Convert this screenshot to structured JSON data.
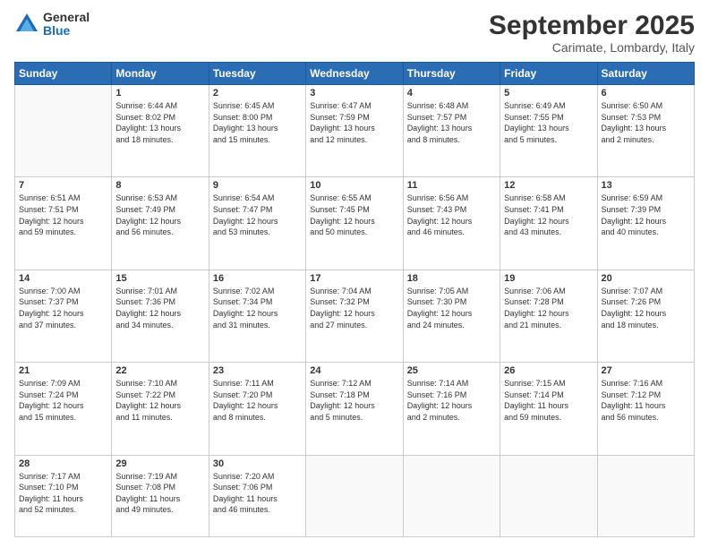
{
  "logo": {
    "general": "General",
    "blue": "Blue"
  },
  "title": "September 2025",
  "subtitle": "Carimate, Lombardy, Italy",
  "headers": [
    "Sunday",
    "Monday",
    "Tuesday",
    "Wednesday",
    "Thursday",
    "Friday",
    "Saturday"
  ],
  "weeks": [
    [
      {
        "day": "",
        "info": ""
      },
      {
        "day": "1",
        "info": "Sunrise: 6:44 AM\nSunset: 8:02 PM\nDaylight: 13 hours\nand 18 minutes."
      },
      {
        "day": "2",
        "info": "Sunrise: 6:45 AM\nSunset: 8:00 PM\nDaylight: 13 hours\nand 15 minutes."
      },
      {
        "day": "3",
        "info": "Sunrise: 6:47 AM\nSunset: 7:59 PM\nDaylight: 13 hours\nand 12 minutes."
      },
      {
        "day": "4",
        "info": "Sunrise: 6:48 AM\nSunset: 7:57 PM\nDaylight: 13 hours\nand 8 minutes."
      },
      {
        "day": "5",
        "info": "Sunrise: 6:49 AM\nSunset: 7:55 PM\nDaylight: 13 hours\nand 5 minutes."
      },
      {
        "day": "6",
        "info": "Sunrise: 6:50 AM\nSunset: 7:53 PM\nDaylight: 13 hours\nand 2 minutes."
      }
    ],
    [
      {
        "day": "7",
        "info": "Sunrise: 6:51 AM\nSunset: 7:51 PM\nDaylight: 12 hours\nand 59 minutes."
      },
      {
        "day": "8",
        "info": "Sunrise: 6:53 AM\nSunset: 7:49 PM\nDaylight: 12 hours\nand 56 minutes."
      },
      {
        "day": "9",
        "info": "Sunrise: 6:54 AM\nSunset: 7:47 PM\nDaylight: 12 hours\nand 53 minutes."
      },
      {
        "day": "10",
        "info": "Sunrise: 6:55 AM\nSunset: 7:45 PM\nDaylight: 12 hours\nand 50 minutes."
      },
      {
        "day": "11",
        "info": "Sunrise: 6:56 AM\nSunset: 7:43 PM\nDaylight: 12 hours\nand 46 minutes."
      },
      {
        "day": "12",
        "info": "Sunrise: 6:58 AM\nSunset: 7:41 PM\nDaylight: 12 hours\nand 43 minutes."
      },
      {
        "day": "13",
        "info": "Sunrise: 6:59 AM\nSunset: 7:39 PM\nDaylight: 12 hours\nand 40 minutes."
      }
    ],
    [
      {
        "day": "14",
        "info": "Sunrise: 7:00 AM\nSunset: 7:37 PM\nDaylight: 12 hours\nand 37 minutes."
      },
      {
        "day": "15",
        "info": "Sunrise: 7:01 AM\nSunset: 7:36 PM\nDaylight: 12 hours\nand 34 minutes."
      },
      {
        "day": "16",
        "info": "Sunrise: 7:02 AM\nSunset: 7:34 PM\nDaylight: 12 hours\nand 31 minutes."
      },
      {
        "day": "17",
        "info": "Sunrise: 7:04 AM\nSunset: 7:32 PM\nDaylight: 12 hours\nand 27 minutes."
      },
      {
        "day": "18",
        "info": "Sunrise: 7:05 AM\nSunset: 7:30 PM\nDaylight: 12 hours\nand 24 minutes."
      },
      {
        "day": "19",
        "info": "Sunrise: 7:06 AM\nSunset: 7:28 PM\nDaylight: 12 hours\nand 21 minutes."
      },
      {
        "day": "20",
        "info": "Sunrise: 7:07 AM\nSunset: 7:26 PM\nDaylight: 12 hours\nand 18 minutes."
      }
    ],
    [
      {
        "day": "21",
        "info": "Sunrise: 7:09 AM\nSunset: 7:24 PM\nDaylight: 12 hours\nand 15 minutes."
      },
      {
        "day": "22",
        "info": "Sunrise: 7:10 AM\nSunset: 7:22 PM\nDaylight: 12 hours\nand 11 minutes."
      },
      {
        "day": "23",
        "info": "Sunrise: 7:11 AM\nSunset: 7:20 PM\nDaylight: 12 hours\nand 8 minutes."
      },
      {
        "day": "24",
        "info": "Sunrise: 7:12 AM\nSunset: 7:18 PM\nDaylight: 12 hours\nand 5 minutes."
      },
      {
        "day": "25",
        "info": "Sunrise: 7:14 AM\nSunset: 7:16 PM\nDaylight: 12 hours\nand 2 minutes."
      },
      {
        "day": "26",
        "info": "Sunrise: 7:15 AM\nSunset: 7:14 PM\nDaylight: 11 hours\nand 59 minutes."
      },
      {
        "day": "27",
        "info": "Sunrise: 7:16 AM\nSunset: 7:12 PM\nDaylight: 11 hours\nand 56 minutes."
      }
    ],
    [
      {
        "day": "28",
        "info": "Sunrise: 7:17 AM\nSunset: 7:10 PM\nDaylight: 11 hours\nand 52 minutes."
      },
      {
        "day": "29",
        "info": "Sunrise: 7:19 AM\nSunset: 7:08 PM\nDaylight: 11 hours\nand 49 minutes."
      },
      {
        "day": "30",
        "info": "Sunrise: 7:20 AM\nSunset: 7:06 PM\nDaylight: 11 hours\nand 46 minutes."
      },
      {
        "day": "",
        "info": ""
      },
      {
        "day": "",
        "info": ""
      },
      {
        "day": "",
        "info": ""
      },
      {
        "day": "",
        "info": ""
      }
    ]
  ]
}
